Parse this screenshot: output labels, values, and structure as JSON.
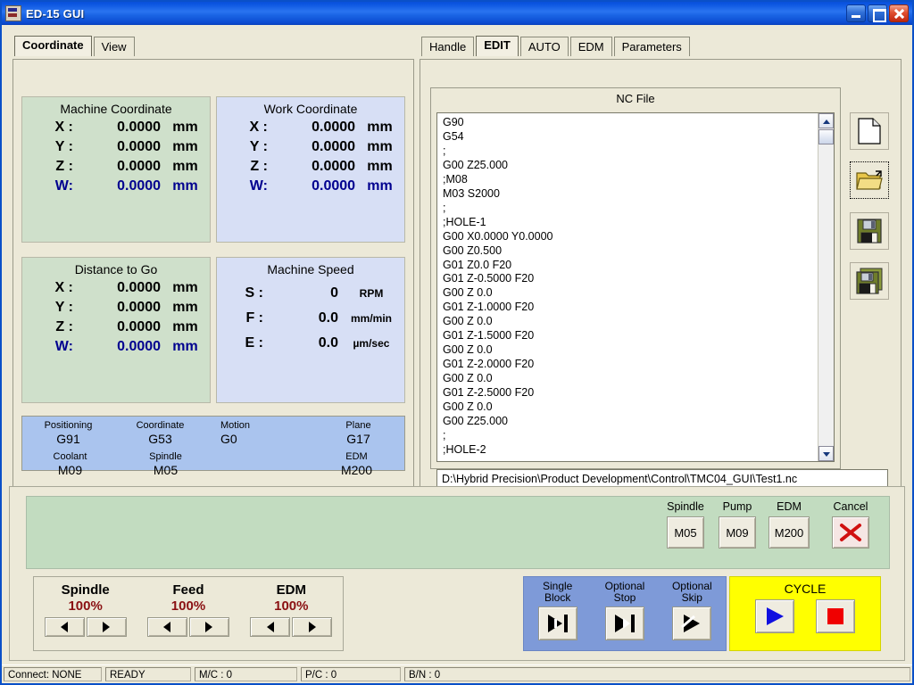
{
  "window": {
    "title": "ED-15 GUI",
    "icon": "app-icon",
    "minimize": "minimize",
    "maximize": "maximize",
    "close": "close"
  },
  "left_tabs": [
    {
      "label": "Coordinate",
      "selected": true
    },
    {
      "label": "View",
      "selected": false
    }
  ],
  "right_tabs": [
    {
      "label": "Handle",
      "selected": false
    },
    {
      "label": "EDIT",
      "selected": true
    },
    {
      "label": "AUTO",
      "selected": false
    },
    {
      "label": "EDM",
      "selected": false
    },
    {
      "label": "Parameters",
      "selected": false
    }
  ],
  "machine_coordinate": {
    "title": "Machine Coordinate",
    "rows": [
      {
        "label": "X :",
        "value": "0.0000",
        "unit": "mm"
      },
      {
        "label": "Y :",
        "value": "0.0000",
        "unit": "mm"
      },
      {
        "label": "Z :",
        "value": "0.0000",
        "unit": "mm"
      },
      {
        "label": "W:",
        "value": "0.0000",
        "unit": "mm"
      }
    ]
  },
  "work_coordinate": {
    "title": "Work Coordinate",
    "rows": [
      {
        "label": "X :",
        "value": "0.0000",
        "unit": "mm"
      },
      {
        "label": "Y :",
        "value": "0.0000",
        "unit": "mm"
      },
      {
        "label": "Z :",
        "value": "0.0000",
        "unit": "mm"
      },
      {
        "label": "W:",
        "value": "0.0000",
        "unit": "mm"
      }
    ]
  },
  "distance_to_go": {
    "title": "Distance to Go",
    "rows": [
      {
        "label": "X :",
        "value": "0.0000",
        "unit": "mm"
      },
      {
        "label": "Y :",
        "value": "0.0000",
        "unit": "mm"
      },
      {
        "label": "Z :",
        "value": "0.0000",
        "unit": "mm"
      },
      {
        "label": "W:",
        "value": "0.0000",
        "unit": "mm"
      }
    ]
  },
  "machine_speed": {
    "title": "Machine Speed",
    "rows": [
      {
        "label": "S :",
        "value": "0",
        "unit": "RPM"
      },
      {
        "label": "F :",
        "value": "0.0",
        "unit": "mm/min"
      },
      {
        "label": "E :",
        "value": "0.0",
        "unit": "µm/sec"
      }
    ]
  },
  "modal_status": {
    "row1": [
      {
        "key": "Positioning",
        "value": "G91"
      },
      {
        "key": "Coordinate",
        "value": "G53"
      },
      {
        "key": "Motion",
        "value": "G0"
      },
      {
        "key": "Plane",
        "value": "G17"
      }
    ],
    "row2": [
      {
        "key": "Coolant",
        "value": "M09"
      },
      {
        "key": "Spindle",
        "value": "M05"
      },
      {
        "key": "",
        "value": ""
      },
      {
        "key": "EDM",
        "value": "M200"
      }
    ]
  },
  "nc_file": {
    "title": "NC File",
    "text": "G90\nG54\n;\nG00 Z25.000\n;M08\nM03 S2000\n;\n;HOLE-1\nG00 X0.0000 Y0.0000\nG00 Z0.500\nG01 Z0.0 F20\nG01 Z-0.5000 F20\nG00 Z 0.0\nG01 Z-1.0000 F20\nG00 Z 0.0\nG01 Z-1.5000 F20\nG00 Z 0.0\nG01 Z-2.0000 F20\nG00 Z 0.0\nG01 Z-2.5000 F20\nG00 Z 0.0\nG00 Z25.000\n;\n;HOLE-2",
    "path": "D:\\Hybrid Precision\\Product Development\\Control\\TMC04_GUI\\Test1.nc",
    "scroll_up": "scroll-up",
    "scroll_down": "scroll-down"
  },
  "file_toolbar": [
    {
      "name": "new-file-button",
      "icon": "new-file-icon",
      "focused": false
    },
    {
      "name": "open-file-button",
      "icon": "open-folder-icon",
      "focused": true
    },
    {
      "name": "save-file-button",
      "icon": "save-icon",
      "focused": false
    },
    {
      "name": "save-as-file-button",
      "icon": "save-as-icon",
      "focused": false
    }
  ],
  "mcode_bar": [
    {
      "key": "Spindle",
      "value": "M05"
    },
    {
      "key": "Pump",
      "value": "M09"
    },
    {
      "key": "EDM",
      "value": "M200"
    },
    {
      "key": "Cancel",
      "value": "",
      "icon": "red-x-icon"
    }
  ],
  "overrides": [
    {
      "label": "Spindle",
      "percent": "100%",
      "dec": "decrease",
      "inc": "increase"
    },
    {
      "label": "Feed",
      "percent": "100%",
      "dec": "decrease",
      "inc": "increase"
    },
    {
      "label": "EDM",
      "percent": "100%",
      "dec": "decrease",
      "inc": "increase"
    }
  ],
  "block_modes": [
    {
      "line1": "Single",
      "line2": "Block",
      "icon": "single-block-icon"
    },
    {
      "line1": "Optional",
      "line2": "Stop",
      "icon": "optional-stop-icon"
    },
    {
      "line1": "Optional",
      "line2": "Skip",
      "icon": "optional-skip-icon"
    }
  ],
  "cycle": {
    "title": "CYCLE",
    "start": "cycle-start",
    "stop": "cycle-stop"
  },
  "status_bar": [
    "Connect: NONE",
    "READY",
    "M/C : 0",
    "P/C : 0",
    "B/N : 0"
  ],
  "colors": {
    "green_panel": "#cfe0cb",
    "blue_panel": "#d7dff5",
    "modal_blue": "#aac4ee",
    "control_green": "#c2dcc0",
    "block_blue": "#7e9ad8",
    "cycle_yellow": "#ffff00",
    "override_red": "#8a1012",
    "w_axis_blue": "#00008f"
  }
}
